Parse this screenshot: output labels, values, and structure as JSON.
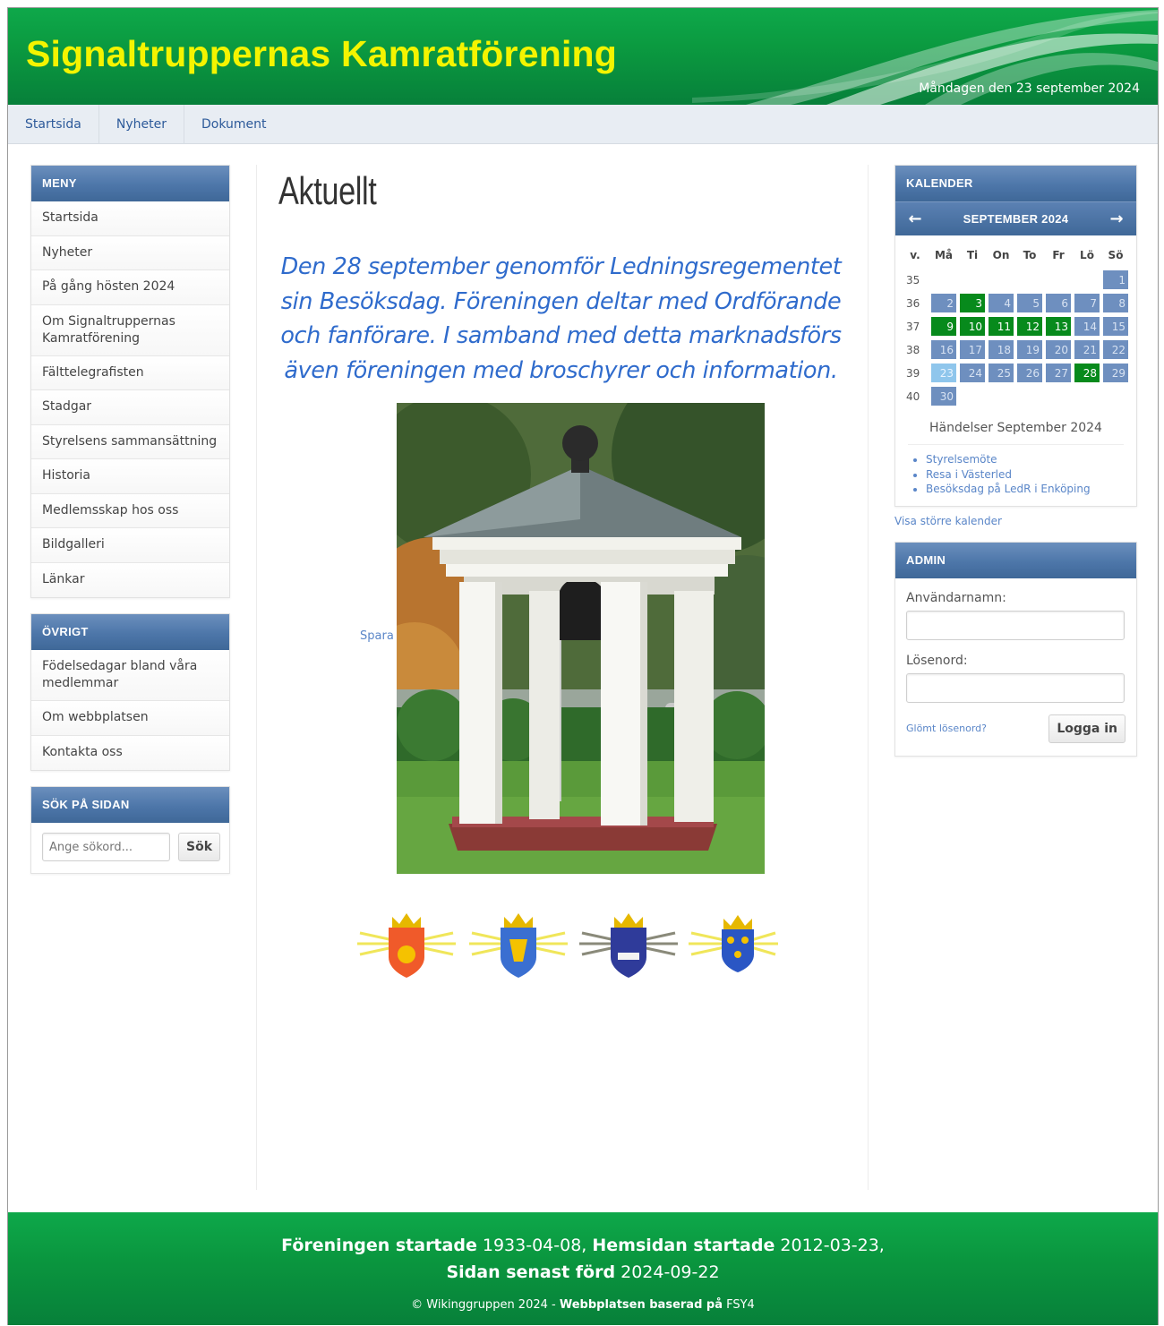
{
  "header": {
    "site_title": "Signaltruppernas Kamratförening",
    "date_text": "Måndagen den 23 september 2024"
  },
  "topnav": [
    "Startsida",
    "Nyheter",
    "Dokument"
  ],
  "menu": {
    "title": "MENY",
    "items": [
      "Startsida",
      "Nyheter",
      "På gång hösten 2024",
      "Om Signaltruppernas Kamratförening",
      "Fälttelegrafisten",
      "Stadgar",
      "Styrelsens sammansättning",
      "Historia",
      "Medlemsskap hos oss",
      "Bildgalleri",
      "Länkar"
    ]
  },
  "ovrigt": {
    "title": "ÖVRIGT",
    "items": [
      "Födelsedagar bland våra medlemmar",
      "Om webbplatsen",
      "Kontakta oss"
    ]
  },
  "search": {
    "title": "SÖK PÅ SIDAN",
    "placeholder": "Ange sökord...",
    "button": "Sök"
  },
  "main": {
    "title": "Aktuellt",
    "lead": "Den 28 september genomför Ledningsregementet sin Besöksdag. Föreningen deltar med Ordförande och fanförare. I samband med detta marknadsförs även föreningen med broschyrer och information.",
    "spara": "Spara"
  },
  "calendar": {
    "title": "KALENDER",
    "month": "SEPTEMBER 2024",
    "headers": [
      "v.",
      "Må",
      "Ti",
      "On",
      "To",
      "Fr",
      "Lö",
      "Sö"
    ],
    "weeks": [
      {
        "wk": "35",
        "days": [
          "",
          "",
          "",
          "",
          "",
          "",
          "1"
        ]
      },
      {
        "wk": "36",
        "days": [
          "2",
          "3",
          "4",
          "5",
          "6",
          "7",
          "8"
        ]
      },
      {
        "wk": "37",
        "days": [
          "9",
          "10",
          "11",
          "12",
          "13",
          "14",
          "15"
        ]
      },
      {
        "wk": "38",
        "days": [
          "16",
          "17",
          "18",
          "19",
          "20",
          "21",
          "22"
        ]
      },
      {
        "wk": "39",
        "days": [
          "23",
          "24",
          "25",
          "26",
          "27",
          "28",
          "29"
        ]
      },
      {
        "wk": "40",
        "days": [
          "30",
          "",
          "",
          "",
          "",
          "",
          ""
        ]
      }
    ],
    "event_days": [
      "3",
      "9",
      "10",
      "11",
      "12",
      "13",
      "28"
    ],
    "today": "23",
    "events_title": "Händelser September 2024",
    "events": [
      "Styrelsemöte",
      "Resa i Västerled",
      "Besöksdag på LedR i Enköping"
    ],
    "bigger_link": "Visa större kalender"
  },
  "admin": {
    "title": "ADMIN",
    "username_label": "Användarnamn:",
    "password_label": "Lösenord:",
    "forgot": "Glömt lösenord?",
    "login_button": "Logga in"
  },
  "footer": {
    "started_label": "Föreningen startade",
    "started_value": "1933-04-08,",
    "site_label": "Hemsidan startade",
    "site_value": "2012-03-23,",
    "updated_label": "Sidan senast förd",
    "updated_value": "2024-09-22",
    "copy_prefix": "© Wikinggruppen 2024 - ",
    "copy_bold": "Webbplatsen baserad på",
    "copy_suffix": " FSY4"
  },
  "colors": {
    "header_green": "#0b9a40",
    "title_yellow": "#f4f400",
    "panel_blue": "#4d76a9",
    "event_green": "#078a1c",
    "link_blue": "#5a86c8"
  }
}
